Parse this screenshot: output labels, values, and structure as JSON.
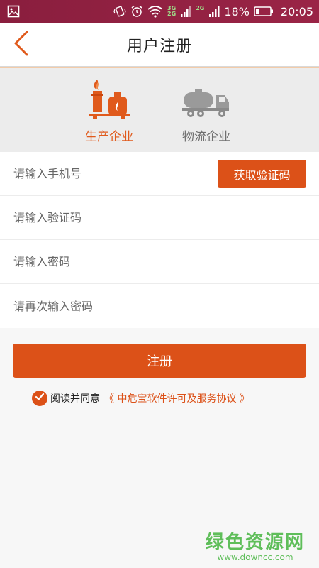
{
  "status_bar": {
    "net_top": "3G",
    "net_bottom": "2G",
    "net_second": "2G",
    "battery_percent": "18%",
    "time": "20:05"
  },
  "header": {
    "title": "用户注册"
  },
  "company_types": [
    {
      "label": "生产企业",
      "selected": true,
      "icon": "factory-icon"
    },
    {
      "label": "物流企业",
      "selected": false,
      "icon": "tanker-truck-icon"
    }
  ],
  "form": {
    "phone_placeholder": "请输入手机号",
    "code_button_label": "获取验证码",
    "code_placeholder": "请输入验证码",
    "password_placeholder": "请输入密码",
    "confirm_placeholder": "请再次输入密码"
  },
  "register_label": "注册",
  "agreement": {
    "checked": true,
    "text": "阅读并同意",
    "link": "《 中危宝软件许可及服务协议 》"
  },
  "watermark": {
    "main": "绿色资源网",
    "sub": "www.downcc.com"
  },
  "colors": {
    "accent": "#dc5118",
    "status_bar": "#8e1f3f",
    "watermark": "#4fb84a"
  }
}
